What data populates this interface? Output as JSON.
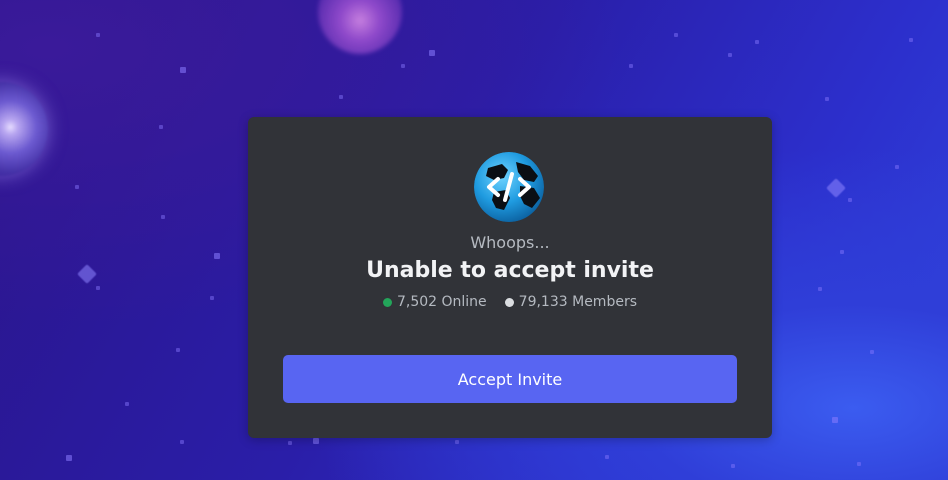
{
  "invite": {
    "server_icon": "globe-code-icon",
    "subtitle": "Whoops...",
    "title": "Unable to accept invite",
    "online_count": "7,502 Online",
    "member_count": "79,133 Members",
    "button_label": "Accept Invite"
  },
  "colors": {
    "card_background": "#313338",
    "button": "#5865f2",
    "online_dot": "#23a55a",
    "members_dot": "#dbdee1",
    "background_primary": "#2a1ea8"
  }
}
